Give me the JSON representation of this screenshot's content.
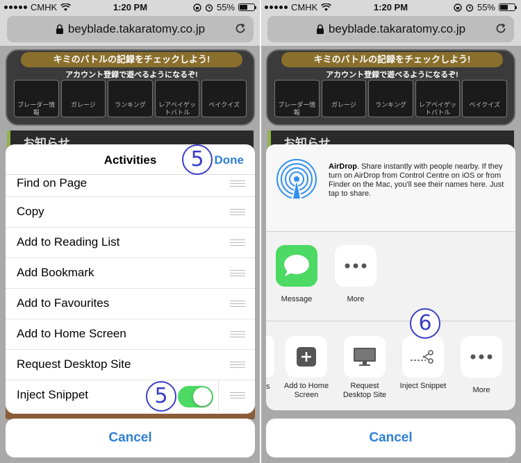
{
  "status": {
    "carrier": "CMHK",
    "time": "1:20 PM",
    "battery": "55%",
    "battery_level": 0.55
  },
  "browser": {
    "url": "beyblade.takaratomy.co.jp"
  },
  "site": {
    "banner_title": "キミのバトルの記録をチェックしよう!",
    "banner_sub": "アカウント登録で遊べるようになるぞ!",
    "slots": [
      "ブレーダー情報",
      "ガレージ",
      "ランキング",
      "レアベイゲットバトル",
      "ベイクイズ"
    ],
    "notice": "お知らせ"
  },
  "activities": {
    "title": "Activities",
    "done_label": "Done",
    "first_item": "Find on Page",
    "items": [
      "Copy",
      "Add to Reading List",
      "Add Bookmark",
      "Add to Favourites",
      "Add to Home Screen",
      "Request Desktop Site"
    ],
    "inject_label": "Inject Snippet",
    "inject_enabled": true,
    "cancel_label": "Cancel"
  },
  "share": {
    "airdrop_title": "AirDrop",
    "airdrop_text": ". Share instantly with people nearby. If they turn on AirDrop from Control Centre on iOS or from Finder on the Mac, you'll see their names here. Just tap to share.",
    "apps": [
      {
        "label": "Message",
        "icon": "message-icon"
      },
      {
        "label": "More",
        "icon": "more-icon"
      }
    ],
    "partial_label": "s",
    "actions": [
      {
        "label": "Add to Home Screen",
        "icon": "add-icon"
      },
      {
        "label": "Request Desktop Site",
        "icon": "desktop-icon"
      },
      {
        "label": "Inject Snippet",
        "icon": "scissors-icon"
      },
      {
        "label": "More",
        "icon": "more-icon"
      }
    ],
    "cancel_label": "Cancel"
  },
  "markers": {
    "step5": "5",
    "step6": "6"
  },
  "colors": {
    "accent_blue": "#2f7fd8",
    "toggle_green": "#4cd964",
    "marker": "#3a3ec4"
  }
}
